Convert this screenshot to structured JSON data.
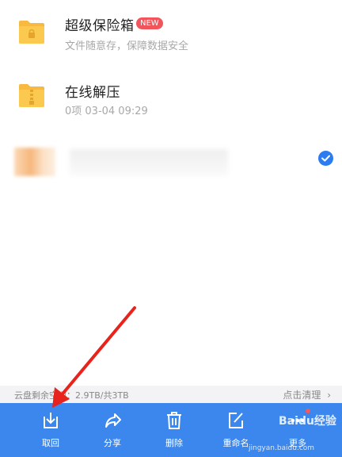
{
  "files": [
    {
      "name": "超级保险箱",
      "badge": "NEW",
      "subtitle": "文件随意存，保障数据安全",
      "icon": "safe-folder-icon"
    },
    {
      "name": "在线解压",
      "subtitle": "0项  03-04 09:29",
      "icon": "zip-folder-icon"
    }
  ],
  "storage": {
    "text": "云盘剩余空间：2.9TB/共3TB",
    "clean_label": "点击清理",
    "clean_icon": "chevron-right-icon"
  },
  "toolbar": {
    "items": [
      {
        "label": "取回",
        "icon": "download-icon"
      },
      {
        "label": "分享",
        "icon": "share-icon"
      },
      {
        "label": "删除",
        "icon": "trash-icon"
      },
      {
        "label": "重命名",
        "icon": "edit-icon"
      },
      {
        "label": "更多",
        "icon": "more-icon"
      }
    ]
  },
  "colors": {
    "accent": "#3b87ee",
    "badge": "#f2545b",
    "folder": "#f7b93f",
    "check": "#2b7cf0"
  },
  "watermark": {
    "brand": "Baidu经验",
    "url": "jingyan.baidu.com"
  }
}
